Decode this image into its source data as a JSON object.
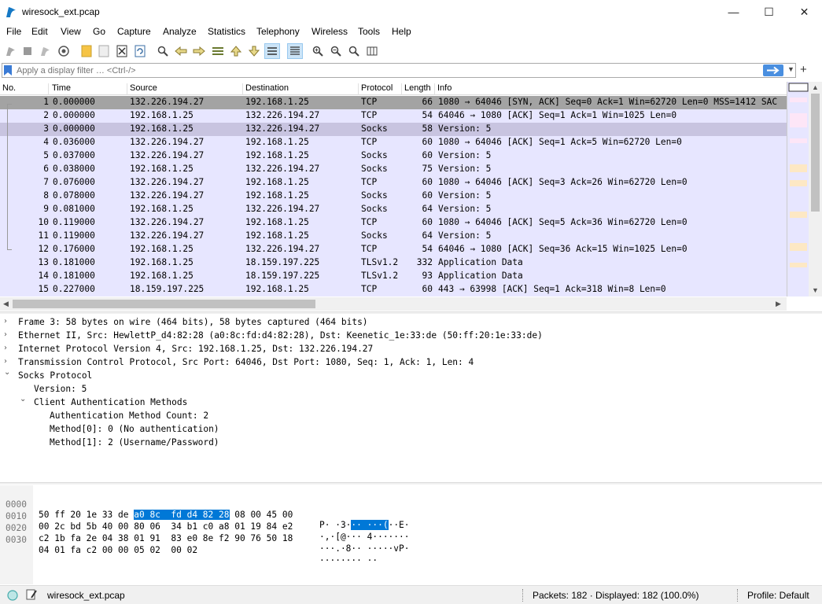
{
  "window": {
    "title": "wiresock_ext.pcap"
  },
  "menu": [
    "File",
    "Edit",
    "View",
    "Go",
    "Capture",
    "Analyze",
    "Statistics",
    "Telephony",
    "Wireless",
    "Tools",
    "Help"
  ],
  "toolbar_icons": [
    "shark-fin-start-icon",
    "stop-icon",
    "restart-icon",
    "options-icon",
    "open-file-icon",
    "file-set-icon",
    "close-file-icon",
    "reload-icon",
    "find-icon",
    "go-back-icon",
    "go-forward-icon",
    "go-to-packet-icon",
    "first-packet-icon",
    "last-packet-icon",
    "autoscroll-icon",
    "colorize-icon",
    "zoom-in-icon",
    "zoom-out-icon",
    "zoom-normal-icon",
    "resize-columns-icon"
  ],
  "filter": {
    "placeholder": "Apply a display filter … <Ctrl-/>"
  },
  "columns": [
    "No.",
    "Time",
    "Source",
    "Destination",
    "Protocol",
    "Length",
    "Info"
  ],
  "packets": [
    {
      "no": "1",
      "time": "0.000000",
      "src": "132.226.194.27",
      "dst": "192.168.1.25",
      "proto": "TCP",
      "len": "66",
      "info": "1080 → 64046 [SYN, ACK] Seq=0 Ack=1 Win=62720 Len=0 MSS=1412 SAC"
    },
    {
      "no": "2",
      "time": "0.000000",
      "src": "192.168.1.25",
      "dst": "132.226.194.27",
      "proto": "TCP",
      "len": "54",
      "info": "64046 → 1080 [ACK] Seq=1 Ack=1 Win=1025 Len=0"
    },
    {
      "no": "3",
      "time": "0.000000",
      "src": "192.168.1.25",
      "dst": "132.226.194.27",
      "proto": "Socks",
      "len": "58",
      "info": "Version: 5"
    },
    {
      "no": "4",
      "time": "0.036000",
      "src": "132.226.194.27",
      "dst": "192.168.1.25",
      "proto": "TCP",
      "len": "60",
      "info": "1080 → 64046 [ACK] Seq=1 Ack=5 Win=62720 Len=0"
    },
    {
      "no": "5",
      "time": "0.037000",
      "src": "132.226.194.27",
      "dst": "192.168.1.25",
      "proto": "Socks",
      "len": "60",
      "info": "Version: 5"
    },
    {
      "no": "6",
      "time": "0.038000",
      "src": "192.168.1.25",
      "dst": "132.226.194.27",
      "proto": "Socks",
      "len": "75",
      "info": "Version: 5"
    },
    {
      "no": "7",
      "time": "0.076000",
      "src": "132.226.194.27",
      "dst": "192.168.1.25",
      "proto": "TCP",
      "len": "60",
      "info": "1080 → 64046 [ACK] Seq=3 Ack=26 Win=62720 Len=0"
    },
    {
      "no": "8",
      "time": "0.078000",
      "src": "132.226.194.27",
      "dst": "192.168.1.25",
      "proto": "Socks",
      "len": "60",
      "info": "Version: 5"
    },
    {
      "no": "9",
      "time": "0.081000",
      "src": "192.168.1.25",
      "dst": "132.226.194.27",
      "proto": "Socks",
      "len": "64",
      "info": "Version: 5"
    },
    {
      "no": "10",
      "time": "0.119000",
      "src": "132.226.194.27",
      "dst": "192.168.1.25",
      "proto": "TCP",
      "len": "60",
      "info": "1080 → 64046 [ACK] Seq=5 Ack=36 Win=62720 Len=0"
    },
    {
      "no": "11",
      "time": "0.119000",
      "src": "132.226.194.27",
      "dst": "192.168.1.25",
      "proto": "Socks",
      "len": "64",
      "info": "Version: 5"
    },
    {
      "no": "12",
      "time": "0.176000",
      "src": "192.168.1.25",
      "dst": "132.226.194.27",
      "proto": "TCP",
      "len": "54",
      "info": "64046 → 1080 [ACK] Seq=36 Ack=15 Win=1025 Len=0"
    },
    {
      "no": "13",
      "time": "0.181000",
      "src": "192.168.1.25",
      "dst": "18.159.197.225",
      "proto": "TLSv1.2",
      "len": "332",
      "info": "Application Data"
    },
    {
      "no": "14",
      "time": "0.181000",
      "src": "192.168.1.25",
      "dst": "18.159.197.225",
      "proto": "TLSv1.2",
      "len": "93",
      "info": "Application Data"
    },
    {
      "no": "15",
      "time": "0.227000",
      "src": "18.159.197.225",
      "dst": "192.168.1.25",
      "proto": "TCP",
      "len": "60",
      "info": "443 → 63998 [ACK] Seq=1 Ack=318 Win=8 Len=0"
    }
  ],
  "details": [
    {
      "text": "Frame 3: 58 bytes on wire (464 bits), 58 bytes captured (464 bits)",
      "chev": "›"
    },
    {
      "text": "Ethernet II, Src: HewlettP_d4:82:28 (a0:8c:fd:d4:82:28), Dst: Keenetic_1e:33:de (50:ff:20:1e:33:de)",
      "chev": "›"
    },
    {
      "text": "Internet Protocol Version 4, Src: 192.168.1.25, Dst: 132.226.194.27",
      "chev": "›"
    },
    {
      "text": "Transmission Control Protocol, Src Port: 64046, Dst Port: 1080, Seq: 1, Ack: 1, Len: 4",
      "chev": "›"
    },
    {
      "text": "Socks Protocol",
      "chev": "⌄"
    },
    {
      "text": "Version: 5",
      "chev": ""
    },
    {
      "text": "Client Authentication Methods",
      "chev": "⌄"
    },
    {
      "text": "Authentication Method Count: 2",
      "chev": ""
    },
    {
      "text": "Method[0]: 0 (No authentication)",
      "chev": ""
    },
    {
      "text": "Method[1]: 2 (Username/Password)",
      "chev": ""
    }
  ],
  "bytes": [
    {
      "off": "0000",
      "hex_a": "50 ff 20 1e 33 de ",
      "hex_sel": "a0 8c  fd d4 82 28",
      "hex_b": " 08 00 45 00",
      "asc_a": "P· ·3·",
      "asc_sel": "·· ···(",
      "asc_b": "··E·"
    },
    {
      "off": "0010",
      "hex_a": "00 2c bd 5b 40 00 80 06  34 b1 c0 a8 01 19 84 e2",
      "hex_sel": "",
      "hex_b": "",
      "asc_a": "·,·[@··· 4·······",
      "asc_sel": "",
      "asc_b": ""
    },
    {
      "off": "0020",
      "hex_a": "c2 1b fa 2e 04 38 01 91  83 e0 8e f2 90 76 50 18",
      "hex_sel": "",
      "hex_b": "",
      "asc_a": "···.·8·· ·····vP·",
      "asc_sel": "",
      "asc_b": ""
    },
    {
      "off": "0030",
      "hex_a": "04 01 fa c2 00 00 05 02  00 02",
      "hex_sel": "",
      "hex_b": "",
      "asc_a": "········ ··",
      "asc_sel": "",
      "asc_b": ""
    }
  ],
  "status": {
    "file": "wiresock_ext.pcap",
    "packets": "Packets: 182 · Displayed: 182 (100.0%)",
    "profile": "Profile: Default"
  },
  "colors": {
    "row_bg": "#e7e6ff",
    "selected": "#a3a3a3",
    "related": "#c8c4e0",
    "accent": "#0078d7"
  }
}
